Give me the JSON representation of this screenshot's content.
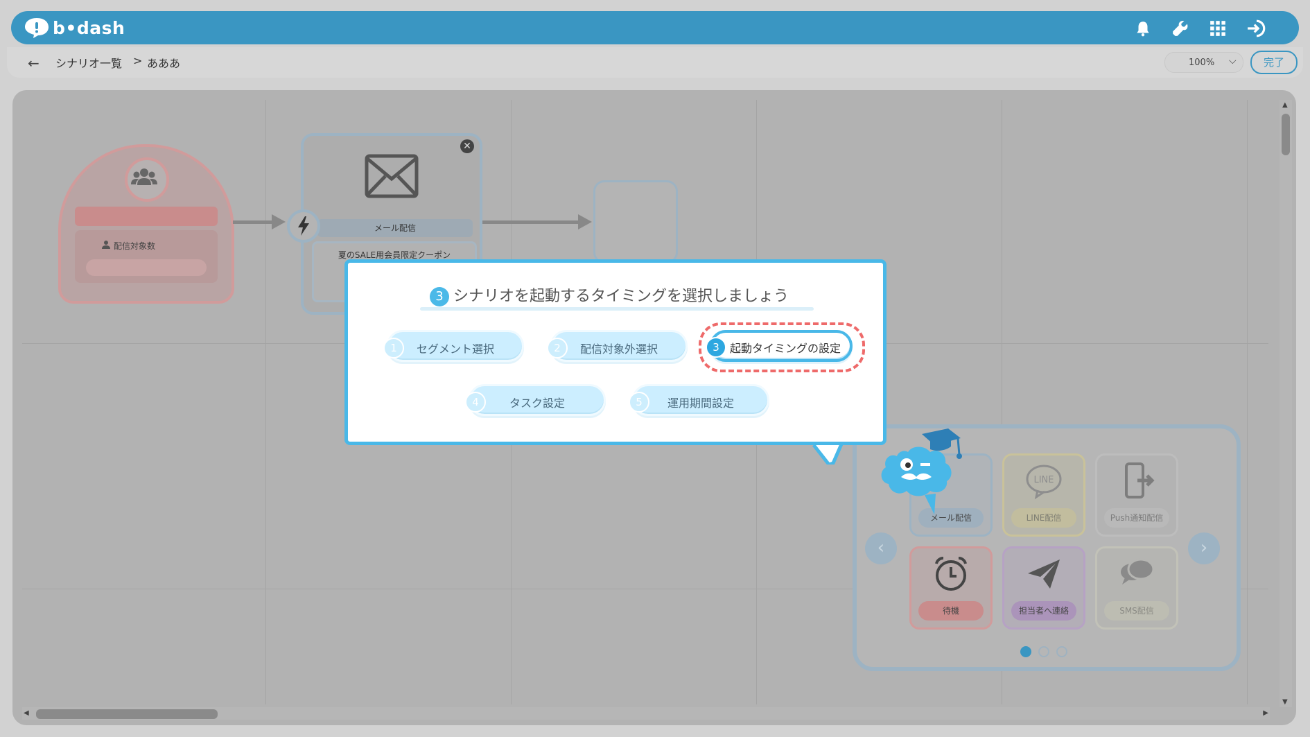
{
  "header": {
    "logo_text": "b•dash",
    "icons": [
      "bell-icon",
      "wrench-icon",
      "grid-icon",
      "logout-icon"
    ]
  },
  "breadcrumb": {
    "back_icon": "←",
    "path": "シナリオ一覧",
    "separator": ">",
    "current": "あああ"
  },
  "toolbar": {
    "zoom": "100%",
    "zoom_chevron": "⌵",
    "done_label": "完了"
  },
  "canvas": {
    "segment_node": {
      "label": "配信対象数"
    },
    "mail_node": {
      "title": "メール配信",
      "content": "夏のSALE用会員限定クーポン",
      "close_symbol": "✕"
    }
  },
  "palette": {
    "tiles": [
      {
        "label": "メール配信",
        "icon": "mail-icon",
        "color": "#9db3c3"
      },
      {
        "label": "LINE配信",
        "icon": "line-icon",
        "color": "#c9c29a"
      },
      {
        "label": "Push通知配信",
        "icon": "mobile-push-icon",
        "color": "#bdbdbd"
      },
      {
        "label": "待機",
        "icon": "alarm-clock-icon",
        "color": "#d19b9b"
      },
      {
        "label": "担当者へ連絡",
        "icon": "paper-plane-icon",
        "color": "#b6a2c4"
      },
      {
        "label": "SMS配信",
        "icon": "chat-bubbles-icon",
        "color": "#c2c2b8"
      }
    ],
    "prev_symbol": "‹",
    "next_symbol": "›",
    "page_dots": 3,
    "active_page": 1
  },
  "tutorial": {
    "title_number": "3",
    "title": "シナリオを起動するタイミングを選択しましょう",
    "steps": [
      {
        "number": "1",
        "label": "セグメント選択",
        "active": false
      },
      {
        "number": "2",
        "label": "配信対象外選択",
        "active": false
      },
      {
        "number": "3",
        "label": "起動タイミングの設定",
        "active": true
      },
      {
        "number": "4",
        "label": "タスク設定",
        "active": false
      },
      {
        "number": "5",
        "label": "運用期間設定",
        "active": false
      }
    ]
  },
  "colors": {
    "brand": "#3a96c2",
    "popup_border": "#49b8e8",
    "highlight": "#ee6a6a"
  }
}
